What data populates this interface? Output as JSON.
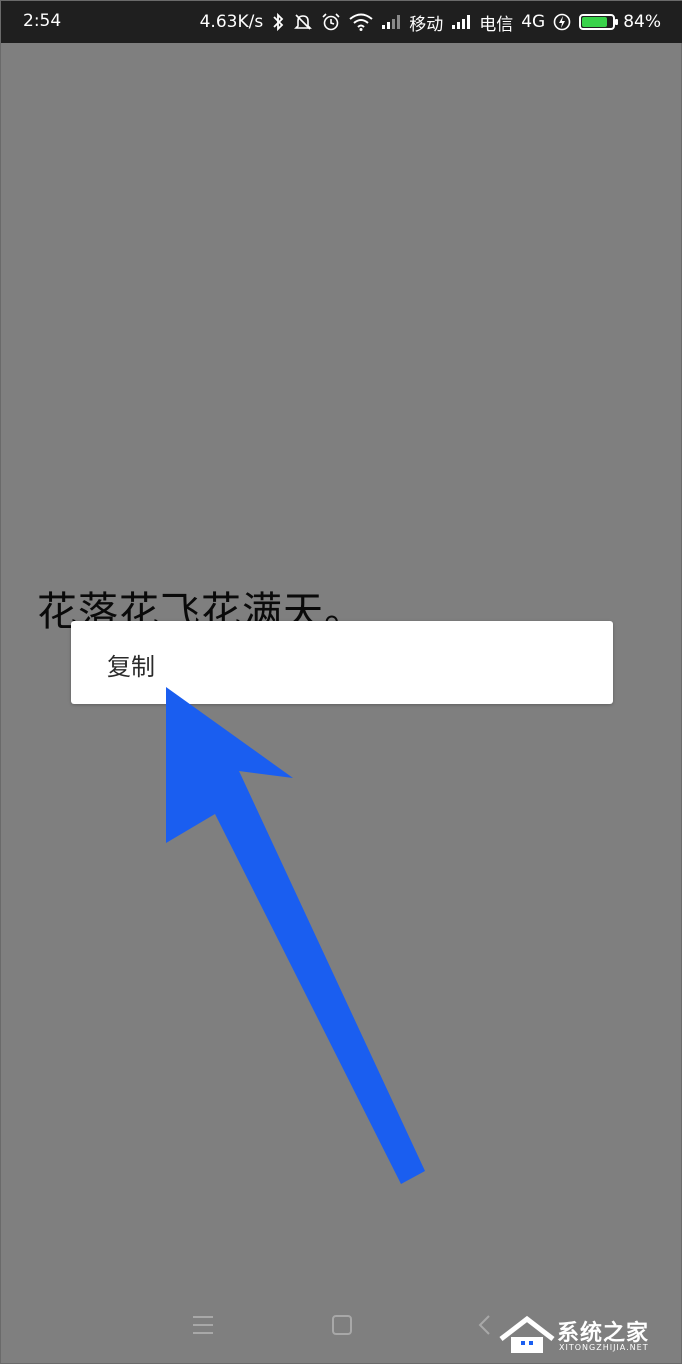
{
  "status_bar": {
    "time": "2:54",
    "net_speed": "4.63K/s",
    "carrier1": "移动",
    "carrier2": "电信",
    "network_type": "4G",
    "battery": "84%",
    "battery_level": 0.84,
    "icons": [
      "bluetooth-icon",
      "mute-bell-icon",
      "alarm-icon",
      "wifi-icon",
      "signal-icon",
      "signal-icon",
      "charging-icon",
      "battery-icon"
    ],
    "colors": {
      "background": "#1f1f1f",
      "battery_fill": "#39d24a"
    }
  },
  "content": {
    "selected_text": "花落花飞花满天。"
  },
  "context_menu": {
    "items": [
      {
        "label": "复制"
      }
    ]
  },
  "annotation": {
    "type": "arrow",
    "color": "#1a5ef0",
    "points_to": "copy-menu-item"
  },
  "nav_bar": {
    "icons": [
      "menu-icon",
      "home-square-icon",
      "back-chevron-icon"
    ]
  },
  "watermark": {
    "text": "系统之家",
    "subtext": "XITONGZHIJIA.NET"
  },
  "colors": {
    "background": "#7f7f7f",
    "menu_background": "#ffffff"
  }
}
